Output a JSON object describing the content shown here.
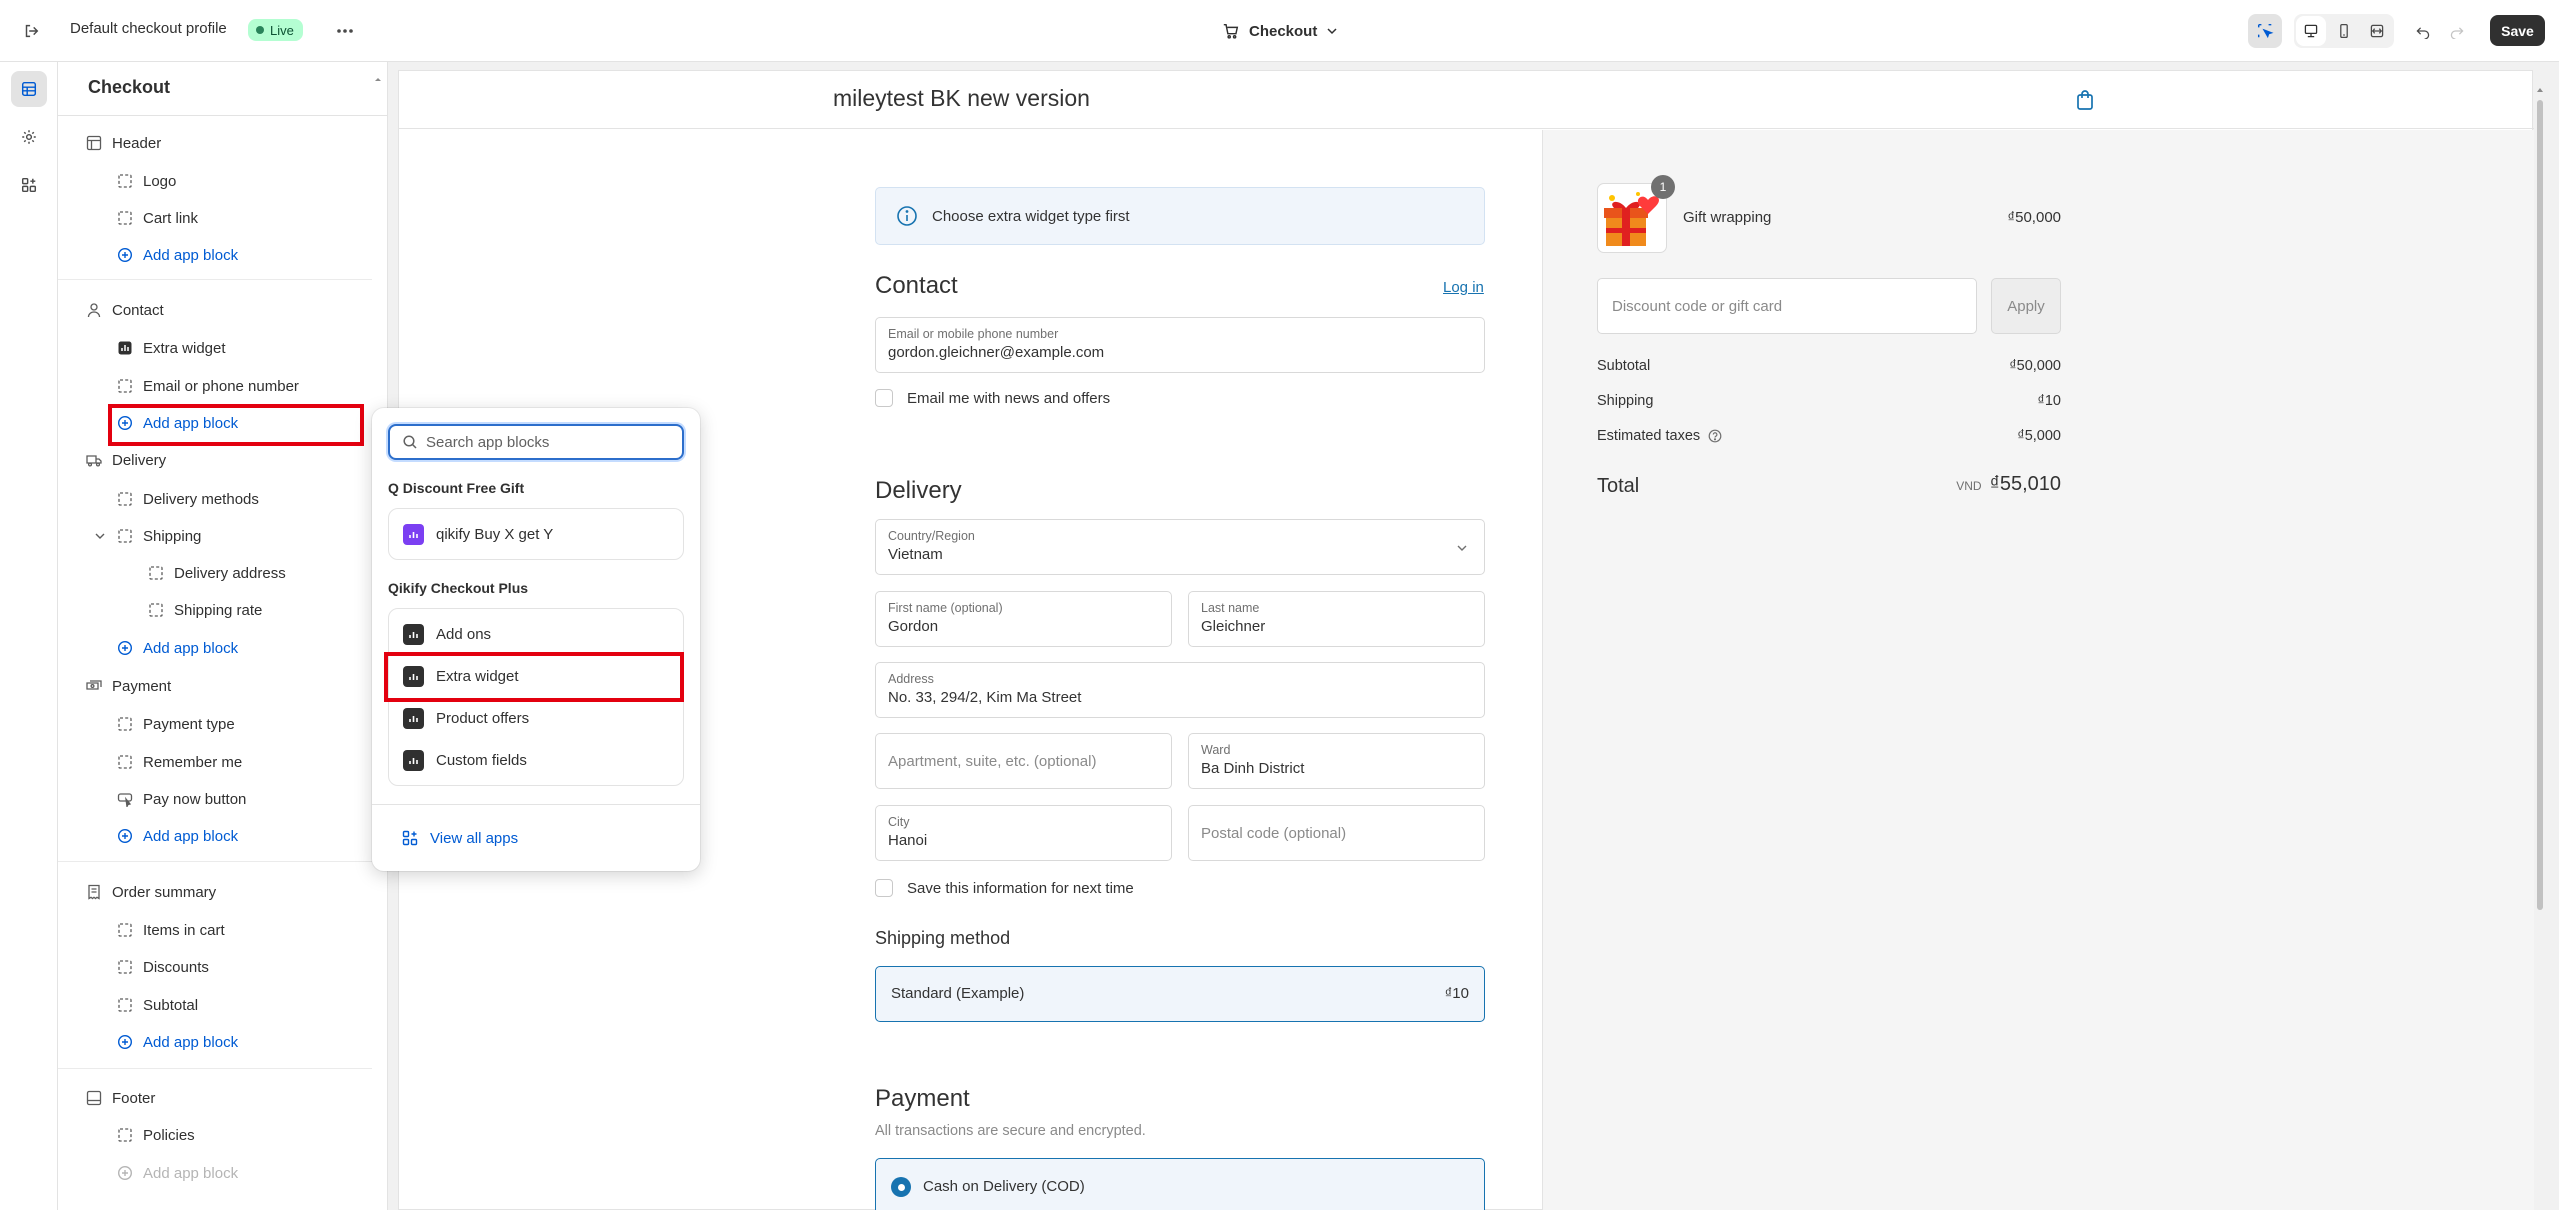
{
  "topbar": {
    "profile_name": "Default checkout profile",
    "live_label": "Live",
    "page_selector": "Checkout",
    "save_label": "Save"
  },
  "sidebar": {
    "title": "Checkout",
    "sections": {
      "header": {
        "label": "Header",
        "items": [
          "Logo",
          "Cart link"
        ],
        "add": "Add app block"
      },
      "contact": {
        "label": "Contact",
        "items": [
          "Extra widget",
          "Email or phone number"
        ],
        "add": "Add app block"
      },
      "delivery": {
        "label": "Delivery",
        "items": [
          "Delivery methods",
          "Shipping",
          "Delivery address",
          "Shipping rate"
        ],
        "add": "Add app block"
      },
      "payment": {
        "label": "Payment",
        "items": [
          "Payment type",
          "Remember me",
          "Pay now button"
        ],
        "add": "Add app block"
      },
      "order_summary": {
        "label": "Order summary",
        "items": [
          "Items in cart",
          "Discounts",
          "Subtotal"
        ],
        "add": "Add app block"
      },
      "footer": {
        "label": "Footer",
        "items": [
          "Policies"
        ],
        "add": "Add app block"
      }
    }
  },
  "popover": {
    "search_placeholder": "Search app blocks",
    "groups": [
      {
        "title": "Q Discount Free Gift",
        "items": [
          "qikify Buy X get Y"
        ]
      },
      {
        "title": "Qikify Checkout Plus",
        "items": [
          "Add ons",
          "Extra widget",
          "Product offers",
          "Custom fields"
        ]
      }
    ],
    "view_all": "View all apps"
  },
  "preview": {
    "store_name": "mileytest BK new version",
    "notice": "Choose extra widget type first",
    "contact": {
      "title": "Contact",
      "login": "Log in",
      "email_label": "Email or mobile phone number",
      "email_value": "gordon.gleichner@example.com",
      "newsletter": "Email me with news and offers"
    },
    "delivery": {
      "title": "Delivery",
      "country_label": "Country/Region",
      "country_value": "Vietnam",
      "first_label": "First name (optional)",
      "first_value": "Gordon",
      "last_label": "Last name",
      "last_value": "Gleichner",
      "address_label": "Address",
      "address_value": "No. 33, 294/2, Kim Ma Street",
      "apt_placeholder": "Apartment, suite, etc. (optional)",
      "ward_label": "Ward",
      "ward_value": "Ba Dinh District",
      "city_label": "City",
      "city_value": "Hanoi",
      "postal_placeholder": "Postal code (optional)",
      "save_info": "Save this information for next time"
    },
    "shipping_method": {
      "title": "Shipping method",
      "option": "Standard (Example)",
      "price": "₫10"
    },
    "payment": {
      "title": "Payment",
      "subtitle": "All transactions are secure and encrypted.",
      "option": "Cash on Delivery (COD)"
    },
    "summary": {
      "product_name": "Gift wrapping",
      "product_price": "₫50,000",
      "quantity": "1",
      "discount_placeholder": "Discount code or gift card",
      "apply": "Apply",
      "subtotal_label": "Subtotal",
      "subtotal_value": "₫50,000",
      "shipping_label": "Shipping",
      "shipping_value": "₫10",
      "taxes_label": "Estimated taxes",
      "taxes_value": "₫5,000",
      "total_label": "Total",
      "total_currency": "VND",
      "total_value": "₫55,010"
    }
  },
  "colors": {
    "accent": "#005bd3",
    "highlight": "#e3000f",
    "checkout_link": "#1773b0"
  }
}
